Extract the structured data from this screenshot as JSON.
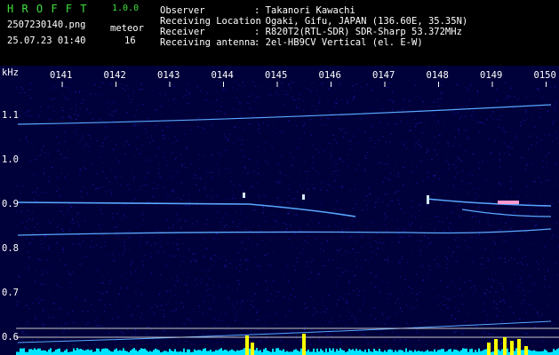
{
  "header": {
    "app_letters": "H R O F F T",
    "version": "1.0.0",
    "filename": "2507230140.png",
    "datetime": "25.07.23 01:40",
    "meteor_label": "meteor",
    "meteor_count": "16",
    "observer_label": "Observer",
    "observer_value": ": Takanori Kawachi",
    "location_label": "Receiving Location",
    "location_value": ": Ogaki, Gifu, JAPAN (136.60E, 35.35N)",
    "receiver_label": "Receiver",
    "receiver_value": ": R820T2(RTL-SDR) SDR-Sharp 53.372MHz",
    "antenna_label": "Receiving antenna",
    "antenna_value": ": 2el-HB9CV Vertical (el. E-W)"
  },
  "plot": {
    "unit": "kHz",
    "minute_labels": [
      "0141",
      "0142",
      "0143",
      "0144",
      "0145",
      "0146",
      "0147",
      "0148",
      "0149",
      "0150"
    ],
    "freq_labels": [
      "1.1",
      "1.0",
      "0.9",
      "0.8",
      "0.7",
      "0.6"
    ],
    "colors": {
      "background": "#00003a",
      "noise": "#1e1ec8",
      "trace": "#5aa8ff",
      "histogram": "#00e5ff",
      "burst": "#ffff00"
    }
  }
}
